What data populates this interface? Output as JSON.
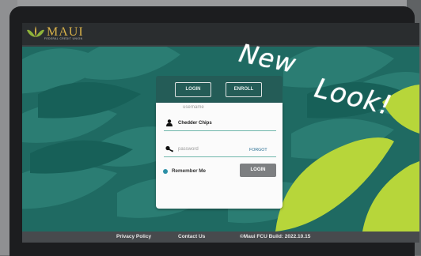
{
  "header": {
    "logo_text": "MAUI",
    "logo_subtext": "FEDERAL CREDIT UNION",
    "logo_colors": {
      "leaf_green": "#8fb33a",
      "leaf_gold": "#d9b24a"
    }
  },
  "login_card": {
    "tabs": [
      {
        "label": "LOGIN"
      },
      {
        "label": "ENROLL"
      }
    ],
    "username_label": "username",
    "username_value": "Chedder Chips",
    "password_placeholder": "password",
    "forgot_label": "FORGOT",
    "remember_label": "Remember Me",
    "login_button": "LOGIN"
  },
  "overlay": {
    "line1": "New",
    "line2": "Look!"
  },
  "footer": {
    "privacy": "Privacy Policy",
    "contact": "Contact Us",
    "copyright": "©Maui FCU  Build: 2022.10.15"
  },
  "colors": {
    "teal_dark": "#1f6a62",
    "teal_light": "#2b7d73",
    "lime": "#b7d63a",
    "footer_bg": "#474a4d"
  }
}
